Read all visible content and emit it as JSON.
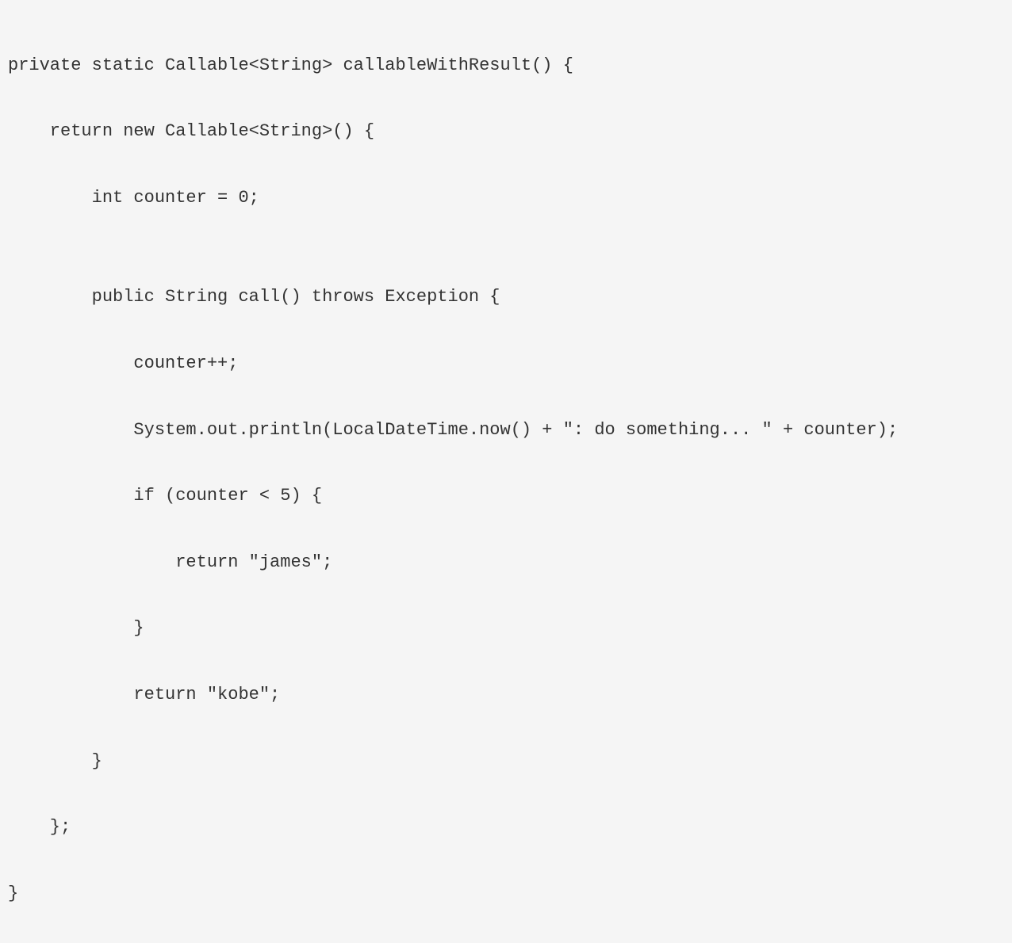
{
  "code": {
    "line1": "private static Callable<String> callableWithResult() {",
    "line2": "    return new Callable<String>() {",
    "line3": "        int counter = 0;",
    "line4": "",
    "line5": "        public String call() throws Exception {",
    "line6": "            counter++;",
    "line7": "            System.out.println(LocalDateTime.now() + \": do something... \" + counter);",
    "line8": "            if (counter < 5) {",
    "line9": "                return \"james\";",
    "line10": "            }",
    "line11": "            return \"kobe\";",
    "line12": "        }",
    "line13": "    };",
    "line14": "}"
  }
}
